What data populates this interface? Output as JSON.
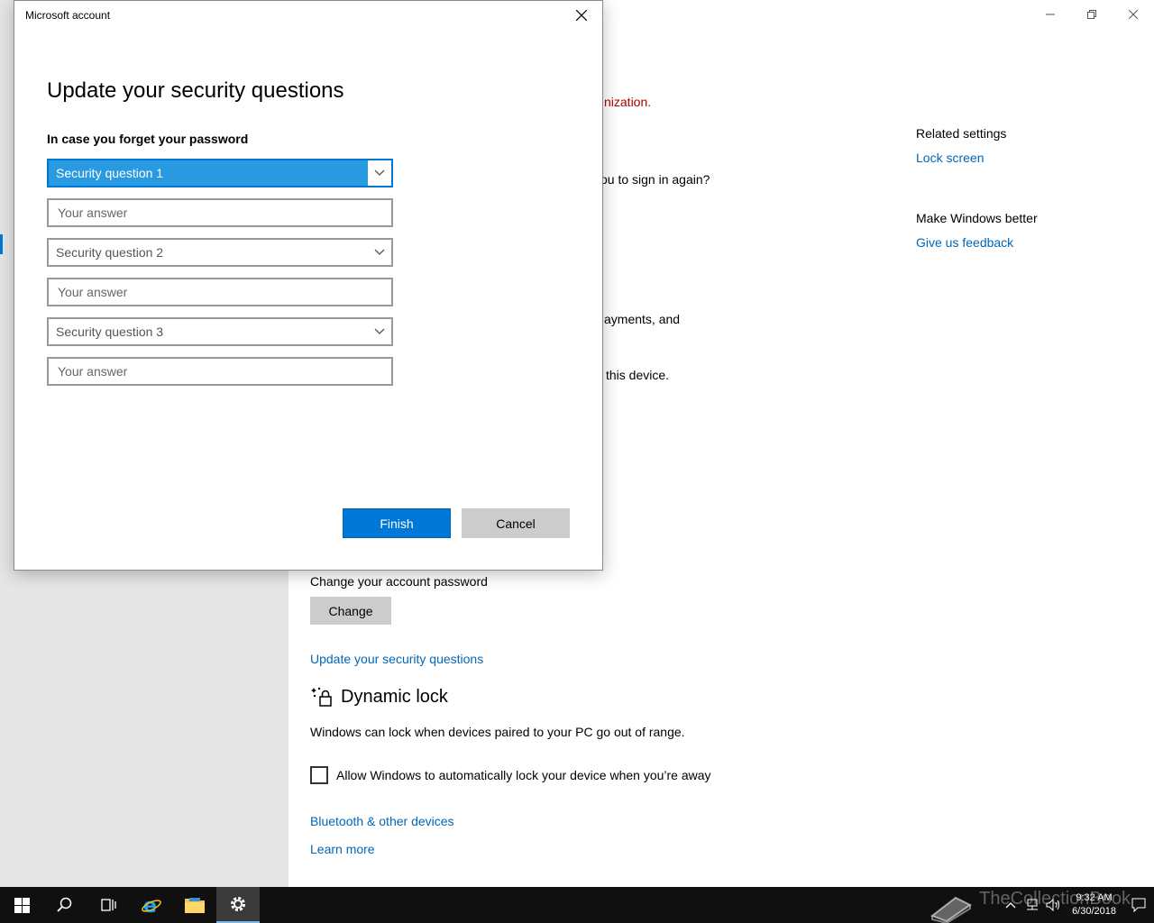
{
  "settings": {
    "window_controls": [
      "minimize",
      "restore",
      "close"
    ],
    "partial_texts": {
      "org_warning": "nization.",
      "sign_in_again": "ou to sign in again?",
      "payments": "ayments, and",
      "device": "this device."
    },
    "related": {
      "related_heading": "Related settings",
      "lock_screen_link": "Lock screen",
      "make_better_heading": "Make Windows better",
      "feedback_link": "Give us feedback"
    },
    "password": {
      "label": "Change your account password",
      "change_button": "Change",
      "security_link": "Update your security questions"
    },
    "dynamic_lock": {
      "title": "Dynamic lock",
      "description": "Windows can lock when devices paired to your PC go out of range.",
      "checkbox_label": "Allow Windows to automatically lock your device when you’re away",
      "checked": false,
      "bluetooth_link": "Bluetooth & other devices",
      "learn_more_link": "Learn more"
    }
  },
  "dialog": {
    "title": "Microsoft account",
    "heading": "Update your security questions",
    "subheading": "In case you forget your password",
    "questions": [
      {
        "select": "Security question 1",
        "answer_placeholder": "Your answer"
      },
      {
        "select": "Security question 2",
        "answer_placeholder": "Your answer"
      },
      {
        "select": "Security question 3",
        "answer_placeholder": "Your answer"
      }
    ],
    "finish_button": "Finish",
    "cancel_button": "Cancel"
  },
  "taskbar": {
    "items": [
      "windows-start-icon",
      "search-icon",
      "task-view-icon",
      "internet-explorer-icon",
      "file-explorer-icon",
      "settings-gear-icon"
    ],
    "time": "9:32 AM",
    "date": "6/30/2018",
    "watermark": "TheCollectionBook"
  },
  "colors": {
    "accent": "#0078d7",
    "link": "#0067b8",
    "warning": "#a80000",
    "sidebar": "#e6e6e6",
    "taskbar": "#101010"
  }
}
